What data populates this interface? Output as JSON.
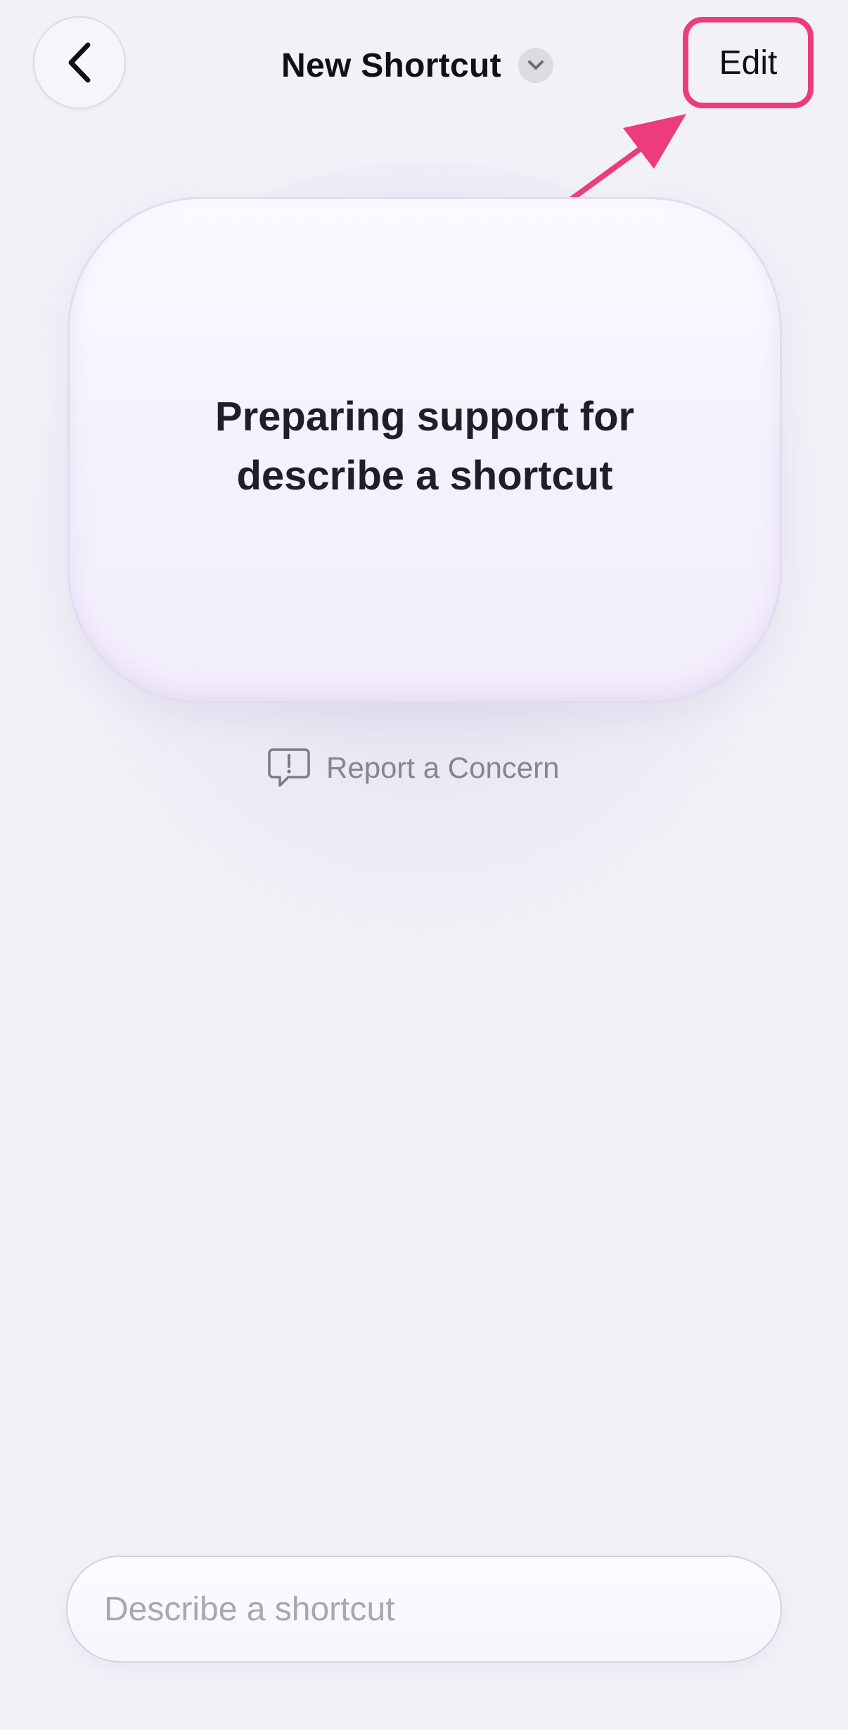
{
  "header": {
    "back_icon": "chevron-left-icon",
    "title": "New Shortcut",
    "title_menu_icon": "chevron-down-icon",
    "edit_label": "Edit"
  },
  "annotation": {
    "highlight_color": "#ec3c7c",
    "arrow_icon": "pointer-arrow-icon"
  },
  "card": {
    "status_text": "Preparing support for describe a shortcut"
  },
  "report": {
    "icon": "exclamation-bubble-icon",
    "label": "Report a Concern"
  },
  "input": {
    "placeholder": "Describe a shortcut"
  }
}
